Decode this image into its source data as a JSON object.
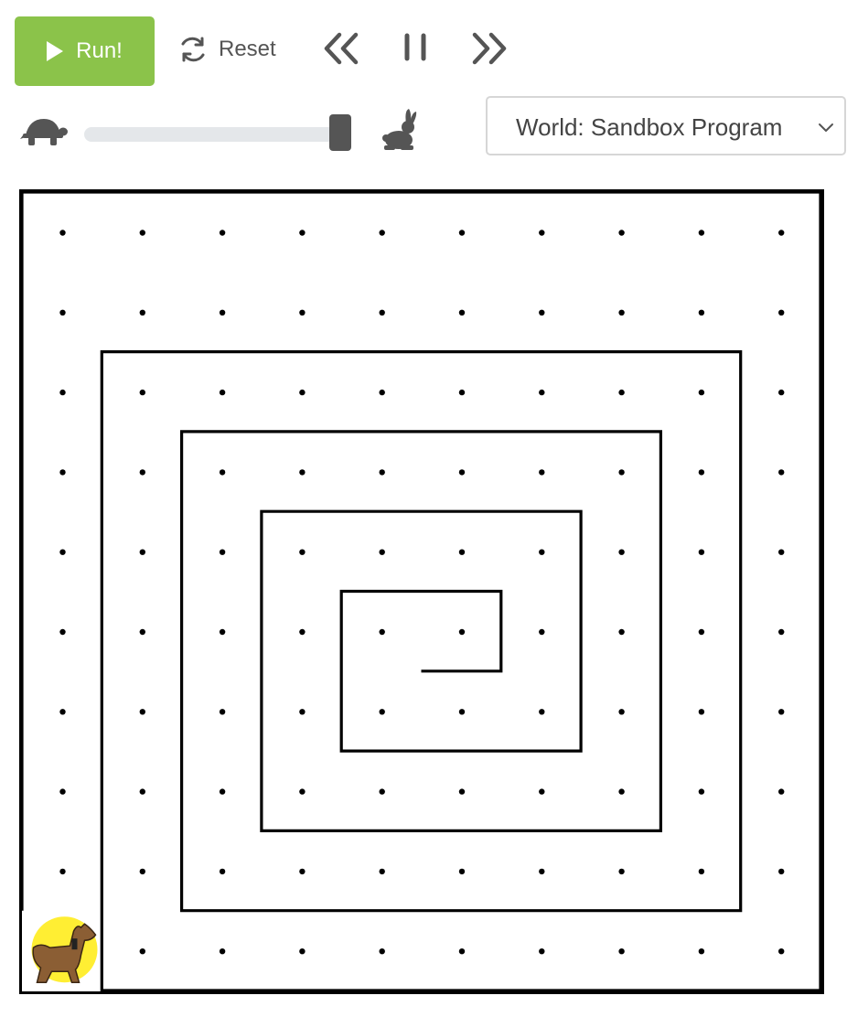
{
  "toolbar": {
    "run_label": "Run!",
    "reset_label": "Reset",
    "run_color": "#8bc34a"
  },
  "icons": {
    "run": "play-icon",
    "reset": "refresh-icon",
    "rewind": "chevrons-left-icon",
    "pause": "pause-icon",
    "forward": "chevrons-right-icon",
    "slow": "turtle-icon",
    "fast": "rabbit-icon",
    "dropdown": "chevron-down-icon"
  },
  "speed": {
    "slider_fraction": 0.98
  },
  "world_select": {
    "selected_label": "World: Sandbox Program"
  },
  "world": {
    "grid": {
      "rows": 10,
      "cols": 10
    },
    "agent": {
      "name": "dog",
      "row": 9,
      "col": 0,
      "highlight_color": "#ffee33"
    },
    "path_cells": [
      [
        9,
        0
      ],
      [
        8,
        0
      ],
      [
        7,
        0
      ],
      [
        6,
        0
      ],
      [
        5,
        0
      ],
      [
        4,
        0
      ],
      [
        3,
        0
      ],
      [
        2,
        0
      ],
      [
        1,
        0
      ],
      [
        0,
        0
      ],
      [
        0,
        1
      ],
      [
        0,
        2
      ],
      [
        0,
        3
      ],
      [
        0,
        4
      ],
      [
        0,
        5
      ],
      [
        0,
        6
      ],
      [
        0,
        7
      ],
      [
        0,
        8
      ],
      [
        0,
        9
      ],
      [
        0,
        10
      ],
      [
        1,
        10
      ],
      [
        2,
        10
      ],
      [
        3,
        10
      ],
      [
        4,
        10
      ],
      [
        5,
        10
      ],
      [
        6,
        10
      ],
      [
        7,
        10
      ],
      [
        8,
        10
      ],
      [
        9,
        10
      ],
      [
        10,
        10
      ],
      [
        10,
        9
      ],
      [
        10,
        8
      ],
      [
        10,
        7
      ],
      [
        10,
        6
      ],
      [
        10,
        5
      ],
      [
        10,
        4
      ],
      [
        10,
        3
      ],
      [
        10,
        2
      ],
      [
        10,
        1
      ],
      [
        9,
        1
      ],
      [
        8,
        1
      ],
      [
        7,
        1
      ],
      [
        6,
        1
      ],
      [
        5,
        1
      ],
      [
        4,
        1
      ],
      [
        3,
        1
      ],
      [
        2,
        1
      ],
      [
        2,
        2
      ],
      [
        2,
        3
      ],
      [
        2,
        4
      ],
      [
        2,
        5
      ],
      [
        2,
        6
      ],
      [
        2,
        7
      ],
      [
        2,
        8
      ],
      [
        2,
        9
      ],
      [
        3,
        9
      ],
      [
        4,
        9
      ],
      [
        5,
        9
      ],
      [
        6,
        9
      ],
      [
        7,
        9
      ],
      [
        8,
        9
      ],
      [
        9,
        9
      ],
      [
        9,
        8
      ],
      [
        9,
        7
      ],
      [
        9,
        6
      ],
      [
        9,
        5
      ],
      [
        9,
        4
      ],
      [
        9,
        3
      ],
      [
        9,
        2
      ],
      [
        8,
        2
      ],
      [
        7,
        2
      ],
      [
        6,
        2
      ],
      [
        5,
        2
      ],
      [
        4,
        2
      ],
      [
        3,
        2
      ],
      [
        3,
        3
      ],
      [
        3,
        4
      ],
      [
        3,
        5
      ],
      [
        3,
        6
      ],
      [
        3,
        7
      ],
      [
        3,
        8
      ],
      [
        4,
        8
      ],
      [
        5,
        8
      ],
      [
        6,
        8
      ],
      [
        7,
        8
      ],
      [
        8,
        8
      ],
      [
        8,
        7
      ],
      [
        8,
        6
      ],
      [
        8,
        5
      ],
      [
        8,
        4
      ],
      [
        8,
        3
      ],
      [
        7,
        3
      ],
      [
        6,
        3
      ],
      [
        5,
        3
      ],
      [
        4,
        3
      ],
      [
        4,
        4
      ],
      [
        4,
        5
      ],
      [
        4,
        6
      ],
      [
        4,
        7
      ],
      [
        5,
        7
      ],
      [
        6,
        7
      ],
      [
        7,
        7
      ],
      [
        7,
        6
      ],
      [
        7,
        5
      ],
      [
        7,
        4
      ],
      [
        6,
        4
      ],
      [
        5,
        4
      ],
      [
        5,
        5
      ],
      [
        5,
        6
      ],
      [
        6,
        6
      ],
      [
        6,
        5
      ]
    ]
  }
}
